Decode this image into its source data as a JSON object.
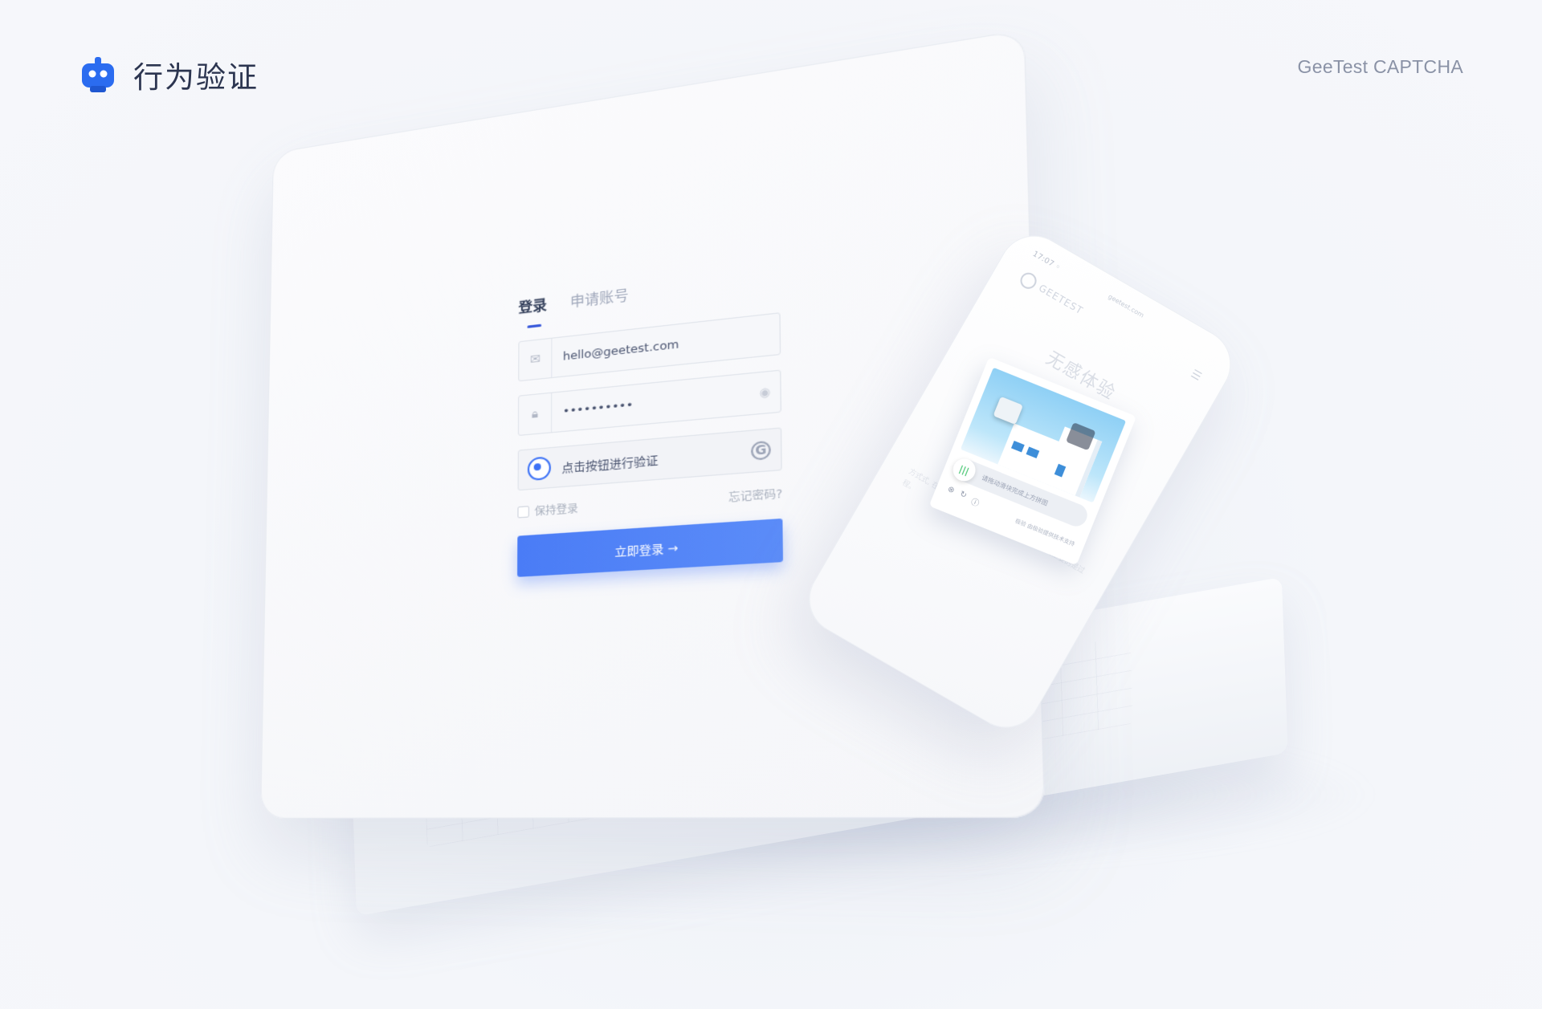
{
  "header": {
    "title": "行为验证",
    "right_label": "GeeTest CAPTCHA"
  },
  "login": {
    "tabs": [
      {
        "label": "登录",
        "active": true
      },
      {
        "label": "申请账号",
        "active": false
      }
    ],
    "email_value": "hello@geetest.com",
    "password_value": "••••••••••",
    "captcha_label": "点击按钮进行验证",
    "captcha_logo": "G",
    "forgot_label": "忘记密码?",
    "remember_label": "保持登录",
    "submit_label": "立即登录 →"
  },
  "phone": {
    "time": "17:07 ◦",
    "url": "geetest.com",
    "brand": "GEETEST",
    "title": "无感体验",
    "paragraph": "方式式, 在让人类就能的流程, 验证不仅提升体验, 更重要的是过程。",
    "captcha": {
      "slider_hint": "请拖动滑块完成上方拼图",
      "foot": "极验 由极验提供技术支持"
    }
  },
  "colors": {
    "accent": "#4a7cf6",
    "brand_blue": "#2b6cf0",
    "title_dark": "#2c3550"
  }
}
